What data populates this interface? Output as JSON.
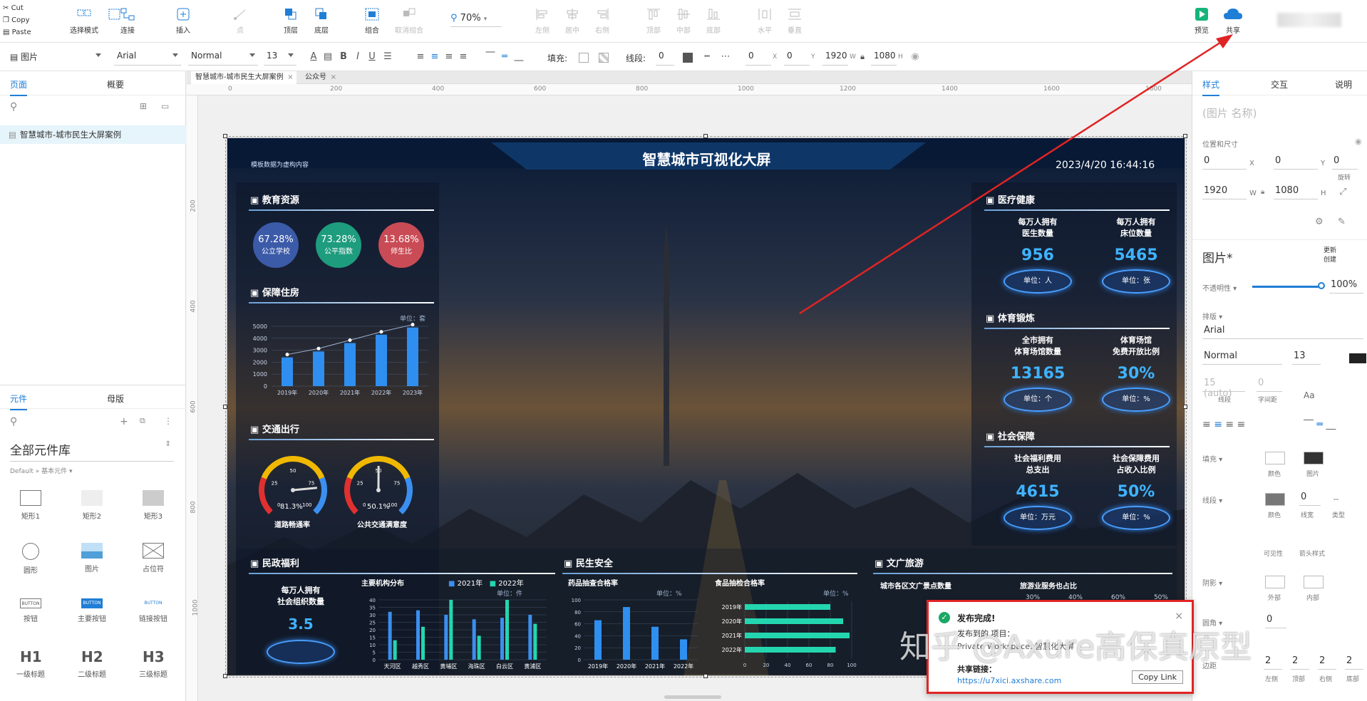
{
  "clipboard": {
    "cut": "Cut",
    "copy": "Copy",
    "paste": "Paste"
  },
  "toolbar": {
    "select": "选择模式",
    "connect": "连接",
    "insert": "插入",
    "point": "点",
    "front": "顶层",
    "back": "底层",
    "group": "组合",
    "ungroup": "取消组合",
    "zoom": "70%",
    "left": "左侧",
    "center": "居中",
    "right": "右侧",
    "top": "顶部",
    "middle": "中部",
    "bottom": "底部",
    "horizontal": "水平",
    "vertical": "垂直",
    "preview": "预览",
    "share": "共享"
  },
  "format": {
    "widget_type": "图片",
    "font": "Arial",
    "style": "Normal",
    "size": "13",
    "fill": "填充:",
    "stroke": "线段:",
    "stroke_val": "0",
    "x": "0",
    "y": "0",
    "w": "1920",
    "h": "1080",
    "x_lbl": "X",
    "y_lbl": "Y",
    "w_lbl": "W",
    "h_lbl": "H"
  },
  "left_panel": {
    "tab_pages": "页面",
    "tab_outline": "概要",
    "page_item": "智慧城市-城市民生大屏案例",
    "tab_widgets": "元件",
    "tab_masters": "母版",
    "library": "全部元件库",
    "library_sub": "Default » 基本元件 ▾",
    "widgets": [
      {
        "label": "矩形1"
      },
      {
        "label": "矩形2"
      },
      {
        "label": "矩形3"
      },
      {
        "label": "圆形"
      },
      {
        "label": "图片"
      },
      {
        "label": "占位符"
      },
      {
        "label": "按钮",
        "glyph": "BUTTON"
      },
      {
        "label": "主要按钮",
        "glyph": "BUTTON"
      },
      {
        "label": "链接按钮",
        "glyph": "BUTTON"
      },
      {
        "label": "一级标题",
        "glyph": "H1"
      },
      {
        "label": "二级标题",
        "glyph": "H2"
      },
      {
        "label": "三级标题",
        "glyph": "H3"
      }
    ]
  },
  "doc_tabs": [
    {
      "label": "智慧城市-城市民生大屏案例"
    },
    {
      "label": "公众号"
    }
  ],
  "ruler_h": [
    "0",
    "200",
    "400",
    "600",
    "800",
    "1000",
    "1200",
    "1400",
    "1600",
    "1800"
  ],
  "ruler_v": [
    "200",
    "400",
    "600",
    "800",
    "1000"
  ],
  "screen": {
    "title": "智慧城市可视化大屏",
    "subtitle": "模板数据为虚构内容",
    "datetime": "2023/4/20 16:44:16",
    "edu": {
      "title": "教育资源",
      "items": [
        {
          "pct": "67.28%",
          "label": "公立学校",
          "color": "#3b5aa8"
        },
        {
          "pct": "73.28%",
          "label": "公平指数",
          "color": "#1e9c7e"
        },
        {
          "pct": "13.68%",
          "label": "师生比",
          "color": "#c94b55"
        }
      ]
    },
    "housing": {
      "title": "保障住房",
      "unit": "单位：套",
      "yticks": [
        "5000",
        "4000",
        "3000",
        "2000",
        "1000",
        "0"
      ],
      "categories": [
        "2019年",
        "2020年",
        "2021年",
        "2022年",
        "2023年"
      ]
    },
    "traffic": {
      "title": "交通出行",
      "g1": {
        "value": "81.3%",
        "label": "道路畅通率"
      },
      "g2": {
        "value": "50.1%",
        "label": "公共交通满意度"
      },
      "ticks": [
        "0",
        "25",
        "50",
        "75",
        "100"
      ]
    },
    "welfare": {
      "title": "民政福利",
      "stat_label": "每万人拥有\n社会组织数量",
      "stat_value": "3.5",
      "dist_title": "主要机构分布",
      "legend1": "2021年",
      "legend2": "2022年",
      "unit": "单位：件",
      "yticks": [
        "40",
        "35",
        "30",
        "25",
        "20",
        "15",
        "10",
        "5",
        "0"
      ],
      "categories": [
        "天河区",
        "越秀区",
        "黄埔区",
        "海珠区",
        "白云区",
        "黄浦区"
      ]
    },
    "safety": {
      "title": "民生安全",
      "drug": "药品抽查合格率",
      "food": "食品抽检合格率",
      "unit1": "单位：%",
      "unit2": "单位：%",
      "yticks": [
        "100",
        "80",
        "60",
        "40",
        "20",
        "0"
      ],
      "categories": [
        "2019年",
        "2020年",
        "2021年",
        "2022年"
      ],
      "food_years": [
        "2019年",
        "2020年",
        "2021年",
        "2022年"
      ],
      "food_ticks": [
        "0",
        "20",
        "40",
        "60",
        "80",
        "100"
      ]
    },
    "tourism": {
      "title": "文广旅游",
      "t1": "城市各区文广景点数量",
      "t2": "旅游业服务也占比",
      "pcts": [
        "30%",
        "40%",
        "60%",
        "50%"
      ]
    },
    "health": {
      "title": "医疗健康",
      "a_label": "每万人拥有\n医生数量",
      "a_value": "956",
      "a_unit": "单位：人",
      "b_label": "每万人拥有\n床位数量",
      "b_value": "5465",
      "b_unit": "单位：张"
    },
    "sport": {
      "title": "体育锻炼",
      "a_label": "全市拥有\n体育场馆数量",
      "a_value": "13165",
      "a_unit": "单位：个",
      "b_label": "体育场馆\n免费开放比例",
      "b_value": "30%",
      "b_unit": "单位：%"
    },
    "social": {
      "title": "社会保障",
      "a_label": "社会福利费用\n总支出",
      "a_value": "4615",
      "a_unit": "单位：万元",
      "b_label": "社会保障费用\n占收入比例",
      "b_value": "50%",
      "b_unit": "单位：%"
    }
  },
  "right_panel": {
    "tab_style": "样式",
    "tab_interact": "交互",
    "tab_notes": "说明",
    "name_placeholder": "(图片 名称)",
    "pos_size": "位置和尺寸",
    "x": "0",
    "y": "0",
    "rot": "0",
    "rot_lbl": "旋转",
    "w": "1920",
    "h": "1080",
    "widget_name": "图片*",
    "update": "更新\n创建",
    "opacity_lbl": "不透明性 ▾",
    "opacity": "100%",
    "typography": "排版 ▾",
    "font": "Arial",
    "style": "Normal",
    "size": "13",
    "line": "15 (auto)",
    "line_lbl": "线段",
    "spacing": "0",
    "spacing_lbl": "字间距",
    "fill": "填充 ▾",
    "fill_color": "颜色",
    "fill_image": "图片",
    "border": "线段 ▾",
    "border_color": "颜色",
    "border_width": "0",
    "border_width_lbl": "线宽",
    "border_type": "类型",
    "visibility": "可见性",
    "arrow": "箭头样式",
    "shadow": "阴影 ▾",
    "outer": "外部",
    "inner": "内部",
    "radius": "圆角 ▾",
    "radius_val": "0",
    "padding": "边距",
    "pad": [
      "2",
      "2",
      "2",
      "2"
    ],
    "pad_lbl": [
      "左侧",
      "顶部",
      "右侧",
      "底部"
    ]
  },
  "popup": {
    "title": "发布完成!",
    "line1": "发布到的 项目：",
    "line2": "Private Workspace: 智慧化大屏",
    "share_label": "共享链接：",
    "link": "https://u7xici.axshare.com",
    "copy": "Copy Link"
  },
  "watermark": "知乎 @Axure高保真原型"
}
